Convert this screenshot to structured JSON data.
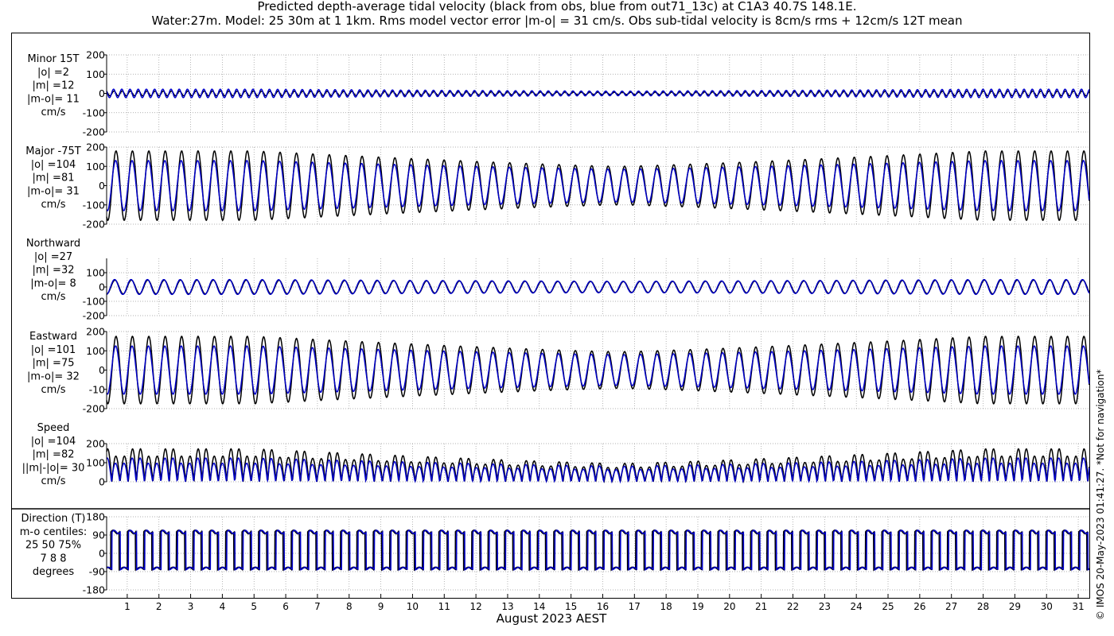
{
  "title_line1": "Predicted depth-average tidal velocity (black from obs, blue from out71_13c) at C1A3 40.7S 148.1E.",
  "title_line2": "Water:27m. Model: 25 30m at 1 1km. Rms model vector error |m-o| = 31 cm/s. Obs sub-tidal velocity is 8cm/s rms + 12cm/s 12T mean",
  "xlabel": "August 2023 AEST",
  "copyright": "© IMOS 20-May-2023 01:41:27.  *Not for navigation*",
  "chart_data": {
    "type": "line",
    "colors": {
      "obs": "#000000",
      "model": "#0000c8"
    },
    "x": {
      "start_day": 0.35,
      "end_day": 31.35,
      "tick_labels": [
        "1",
        "2",
        "3",
        "4",
        "5",
        "6",
        "7",
        "8",
        "9",
        "10",
        "11",
        "12",
        "13",
        "14",
        "15",
        "16",
        "17",
        "18",
        "19",
        "20",
        "21",
        "22",
        "23",
        "24",
        "25",
        "26",
        "27",
        "28",
        "29",
        "30",
        "31"
      ]
    },
    "grid": true,
    "tide": {
      "period_days": 0.5175,
      "neap_day": 16.5,
      "spring_day": 5.0
    },
    "series_names": [
      "obs",
      "model"
    ],
    "panels": [
      {
        "key": "minor",
        "label_lines": [
          "Minor 15T",
          "|o| =2",
          "|m| =12",
          "|m-o|= 11",
          "cm/s"
        ],
        "ylim": [
          -200,
          200
        ],
        "yticks": [
          200,
          100,
          0,
          -100,
          -200
        ],
        "obs_amp": [
          12,
          6
        ],
        "model_amp": [
          22,
          12
        ]
      },
      {
        "key": "major",
        "label_lines": [
          "Major -75T",
          "|o| =104",
          "|m| =81",
          "|m-o|= 31",
          "cm/s"
        ],
        "ylim": [
          -200,
          200
        ],
        "yticks": [
          200,
          100,
          0,
          -100,
          -200
        ],
        "obs_amp": [
          180,
          100
        ],
        "model_amp": [
          130,
          85
        ]
      },
      {
        "key": "north",
        "label_lines": [
          "Northward",
          "|o| =27",
          "|m| =32",
          "|m-o|= 8",
          "cm/s"
        ],
        "ylim": [
          -200,
          200
        ],
        "yticks": [
          100,
          0,
          -100,
          -200
        ],
        "obs_amp": [
          48,
          38
        ],
        "model_amp": [
          52,
          40
        ]
      },
      {
        "key": "east",
        "label_lines": [
          "Eastward",
          "|o| =101",
          "|m| =75",
          "|m-o|= 32",
          "cm/s"
        ],
        "ylim": [
          -200,
          200
        ],
        "yticks": [
          200,
          100,
          0,
          -100,
          -200
        ],
        "tick_labels_override": {
          "-100": "-10"
        },
        "obs_amp": [
          175,
          95
        ],
        "model_amp": [
          125,
          80
        ]
      },
      {
        "key": "speed",
        "label_lines": [
          "Speed",
          "|o| =104",
          "|m| =82",
          "||m|-|o|= 30",
          "cm/s"
        ],
        "ylim": [
          0,
          200
        ],
        "yticks": [
          200,
          100,
          0
        ],
        "obs_amp": [
          180,
          100
        ],
        "model_amp": [
          130,
          85
        ]
      },
      {
        "key": "dir",
        "label_lines": [
          "Direction (T)",
          "m-o centiles:",
          "25  50  75%",
          "7  8  8",
          "degrees"
        ],
        "ylim": [
          -180,
          180
        ],
        "yticks": [
          180,
          90,
          0,
          -90,
          -180
        ],
        "dir_levels": {
          "high": 105,
          "low": -75
        }
      }
    ]
  }
}
